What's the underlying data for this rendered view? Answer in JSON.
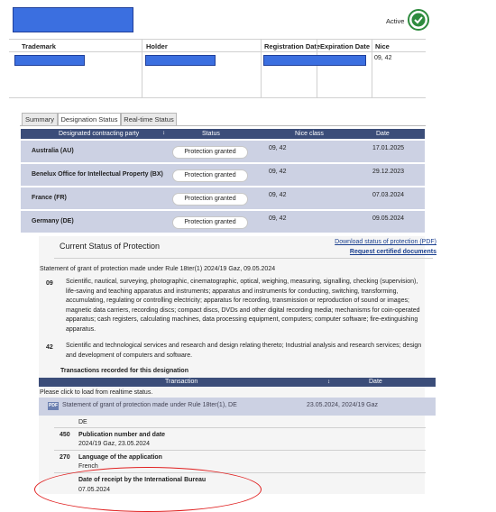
{
  "header": {
    "status_label": "Active"
  },
  "columns": {
    "trademark": "Trademark",
    "holder": "Holder",
    "registration_date": "Registration Date",
    "expiration_date": "Expiration Date",
    "nice": "Nice"
  },
  "record": {
    "nice_value": "09, 42"
  },
  "tabs": [
    {
      "label": "Summary"
    },
    {
      "label": "Designation Status"
    },
    {
      "label": "Real-time Status"
    }
  ],
  "designation_table": {
    "headers": {
      "party": "Designated contracting party",
      "status": "Status",
      "nice": "Nice class",
      "date": "Date"
    },
    "rows": [
      {
        "party": "Australia (AU)",
        "status": "Protection granted",
        "nice": "09, 42",
        "date": "17.01.2025"
      },
      {
        "party": "Benelux Office for Intellectual Property (BX)",
        "status": "Protection granted",
        "nice": "09, 42",
        "date": "29.12.2023"
      },
      {
        "party": "France (FR)",
        "status": "Protection granted",
        "nice": "09, 42",
        "date": "07.03.2024"
      },
      {
        "party": "Germany (DE)",
        "status": "Protection granted",
        "nice": "09, 42",
        "date": "09.05.2024"
      }
    ]
  },
  "detail": {
    "title": "Current Status of Protection",
    "download_link": "Download status of protection (PDF)",
    "request_link": "Request certified documents",
    "statement": "Statement of grant of protection made under Rule 18ter(1) 2024/19 Gaz, 09.05.2024",
    "class_09_num": "09",
    "class_09_text": "Scientific, nautical, surveying, photographic, cinematographic, optical, weighing, measuring, signalling, checking (supervision), life-saving and teaching apparatus and instruments; apparatus and instruments for conducting, switching, transforming, accumulating, regulating or controlling electricity; apparatus for recording, transmission or reproduction of sound or images; magnetic data carriers, recording discs; compact discs, DVDs and other digital recording media; mechanisms for coin-operated apparatus; cash registers, calculating machines, data processing equipment, computers; computer software; fire-extinguishing apparatus.",
    "class_42_num": "42",
    "class_42_text": "Scientific and technological services and research and design relating thereto; Industrial analysis and research services; design and development of computers and software."
  },
  "transactions": {
    "title": "Transactions recorded for this designation",
    "header_transaction": "Transaction",
    "header_date": "Date",
    "note": "Please click to load from realtime status.",
    "pdf_label": "PDF",
    "row_text": "Statement of grant of protection made under Rule 18ter(1), DE",
    "row_date": "23.05.2024, 2024/19 Gaz"
  },
  "fields": {
    "country": "DE",
    "f450_num": "450",
    "f450_label": "Publication number and date",
    "f450_value": "2024/19 Gaz, 23.05.2024",
    "f270_num": "270",
    "f270_label": "Language of the application",
    "f270_value": "French",
    "receipt_label": "Date of receipt by the International Bureau",
    "receipt_value": "07.05.2024"
  },
  "colors": {
    "redaction": "#3b6fe0",
    "table_header": "#3b4d79",
    "row_bg": "#ccd1e3",
    "annotation": "#e02020",
    "status_icon": "#2e8b3e"
  }
}
